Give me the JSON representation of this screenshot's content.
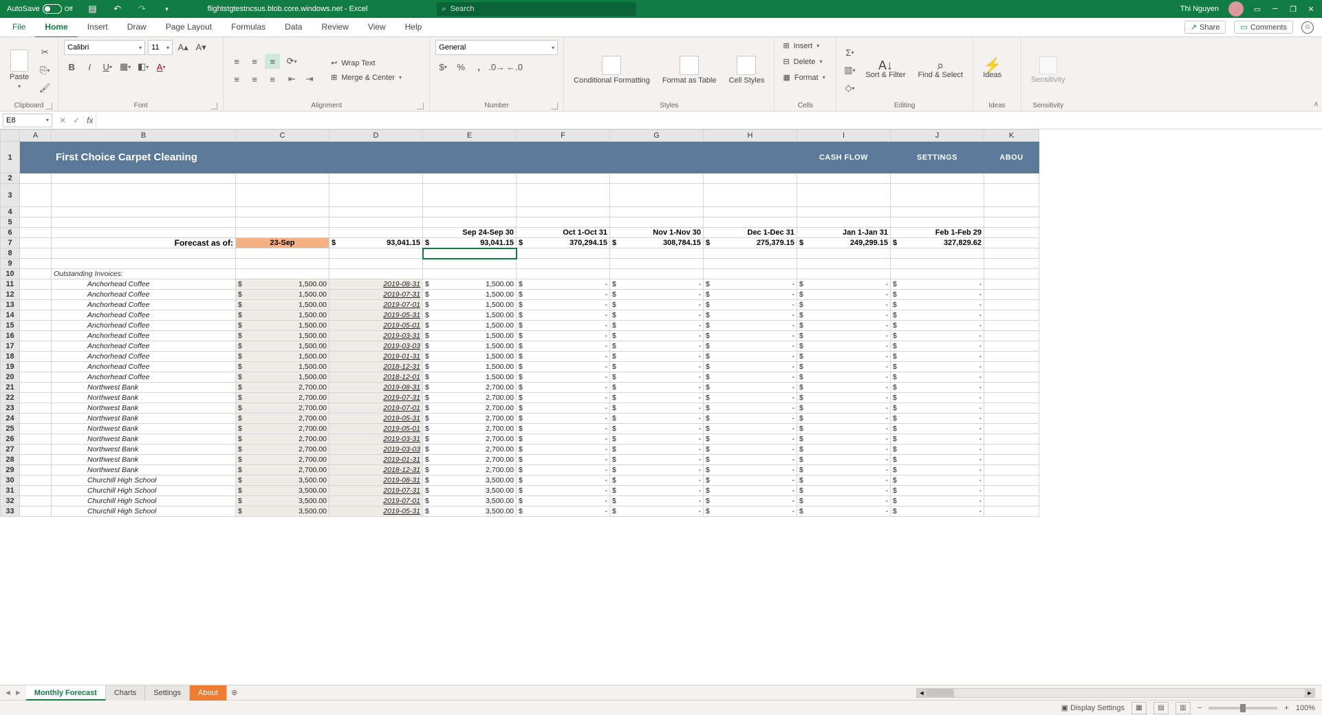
{
  "titlebar": {
    "autosave": "AutoSave",
    "autosave_state": "Off",
    "doc": "flightstgtestncsus.blob.core.windows.net - Excel",
    "search_placeholder": "Search",
    "user": "Thi Nguyen"
  },
  "menu": {
    "tabs": [
      "File",
      "Home",
      "Insert",
      "Draw",
      "Page Layout",
      "Formulas",
      "Data",
      "Review",
      "View",
      "Help"
    ],
    "active": 1,
    "share": "Share",
    "comments": "Comments"
  },
  "ribbon": {
    "clipboard": {
      "paste": "Paste",
      "label": "Clipboard"
    },
    "font": {
      "name": "Calibri",
      "size": "11",
      "label": "Font"
    },
    "alignment": {
      "wrap": "Wrap Text",
      "merge": "Merge & Center",
      "label": "Alignment"
    },
    "number": {
      "format": "General",
      "label": "Number"
    },
    "styles": {
      "cond": "Conditional Formatting",
      "table": "Format as Table",
      "cell": "Cell Styles",
      "label": "Styles"
    },
    "cells": {
      "insert": "Insert",
      "delete": "Delete",
      "format": "Format",
      "label": "Cells"
    },
    "editing": {
      "sort": "Sort & Filter",
      "find": "Find & Select",
      "label": "Editing"
    },
    "ideas": {
      "btn": "Ideas",
      "label": "Ideas"
    },
    "sensitivity": {
      "btn": "Sensitivity",
      "label": "Sensitivity"
    }
  },
  "fbar": {
    "nameBox": "E8"
  },
  "columns": [
    "A",
    "B",
    "C",
    "D",
    "E",
    "F",
    "G",
    "H",
    "I",
    "J",
    "K"
  ],
  "banner": {
    "title": "First Choice Carpet Cleaning",
    "cashflow": "CASH FLOW",
    "settings": "SETTINGS",
    "about": "ABOU"
  },
  "row6": [
    "Sep 24-Sep 30",
    "Oct 1-Oct 31",
    "Nov 1-Nov 30",
    "Dec 1-Dec 31",
    "Jan 1-Jan 31",
    "Feb 1-Feb 29"
  ],
  "row7": {
    "label": "Forecast as of:",
    "date": "23-Sep",
    "vals": [
      "93,041.15",
      "93,041.15",
      "370,294.15",
      "308,784.15",
      "275,379.15",
      "249,299.15",
      "327,829.62"
    ]
  },
  "row10": "Outstanding Invoices:",
  "data": [
    {
      "n": 11,
      "c": "Anchorhead Coffee",
      "a": "1,500.00",
      "d": "2019-08-31",
      "e": "1,500.00"
    },
    {
      "n": 12,
      "c": "Anchorhead Coffee",
      "a": "1,500.00",
      "d": "2019-07-31",
      "e": "1,500.00"
    },
    {
      "n": 13,
      "c": "Anchorhead Coffee",
      "a": "1,500.00",
      "d": "2019-07-01",
      "e": "1,500.00"
    },
    {
      "n": 14,
      "c": "Anchorhead Coffee",
      "a": "1,500.00",
      "d": "2019-05-31",
      "e": "1,500.00"
    },
    {
      "n": 15,
      "c": "Anchorhead Coffee",
      "a": "1,500.00",
      "d": "2019-05-01",
      "e": "1,500.00"
    },
    {
      "n": 16,
      "c": "Anchorhead Coffee",
      "a": "1,500.00",
      "d": "2019-03-31",
      "e": "1,500.00"
    },
    {
      "n": 17,
      "c": "Anchorhead Coffee",
      "a": "1,500.00",
      "d": "2019-03-03",
      "e": "1,500.00"
    },
    {
      "n": 18,
      "c": "Anchorhead Coffee",
      "a": "1,500.00",
      "d": "2019-01-31",
      "e": "1,500.00"
    },
    {
      "n": 19,
      "c": "Anchorhead Coffee",
      "a": "1,500.00",
      "d": "2018-12-31",
      "e": "1,500.00"
    },
    {
      "n": 20,
      "c": "Anchorhead Coffee",
      "a": "1,500.00",
      "d": "2018-12-01",
      "e": "1,500.00"
    },
    {
      "n": 21,
      "c": "Northwest Bank",
      "a": "2,700.00",
      "d": "2019-08-31",
      "e": "2,700.00"
    },
    {
      "n": 22,
      "c": "Northwest Bank",
      "a": "2,700.00",
      "d": "2019-07-31",
      "e": "2,700.00"
    },
    {
      "n": 23,
      "c": "Northwest Bank",
      "a": "2,700.00",
      "d": "2019-07-01",
      "e": "2,700.00"
    },
    {
      "n": 24,
      "c": "Northwest Bank",
      "a": "2,700.00",
      "d": "2019-05-31",
      "e": "2,700.00"
    },
    {
      "n": 25,
      "c": "Northwest Bank",
      "a": "2,700.00",
      "d": "2019-05-01",
      "e": "2,700.00"
    },
    {
      "n": 26,
      "c": "Northwest Bank",
      "a": "2,700.00",
      "d": "2019-03-31",
      "e": "2,700.00"
    },
    {
      "n": 27,
      "c": "Northwest Bank",
      "a": "2,700.00",
      "d": "2019-03-03",
      "e": "2,700.00"
    },
    {
      "n": 28,
      "c": "Northwest Bank",
      "a": "2,700.00",
      "d": "2019-01-31",
      "e": "2,700.00"
    },
    {
      "n": 29,
      "c": "Northwest Bank",
      "a": "2,700.00",
      "d": "2018-12-31",
      "e": "2,700.00"
    },
    {
      "n": 30,
      "c": "Churchill High School",
      "a": "3,500.00",
      "d": "2019-08-31",
      "e": "3,500.00"
    },
    {
      "n": 31,
      "c": "Churchill High School",
      "a": "3,500.00",
      "d": "2019-07-31",
      "e": "3,500.00"
    },
    {
      "n": 32,
      "c": "Churchill High School",
      "a": "3,500.00",
      "d": "2019-07-01",
      "e": "3,500.00"
    },
    {
      "n": 33,
      "c": "Churchill High School",
      "a": "3,500.00",
      "d": "2019-05-31",
      "e": "3,500.00"
    }
  ],
  "sheets": [
    "Monthly Forecast",
    "Charts",
    "Settings",
    "About"
  ],
  "status": {
    "display": "Display Settings",
    "zoom": "100%"
  }
}
